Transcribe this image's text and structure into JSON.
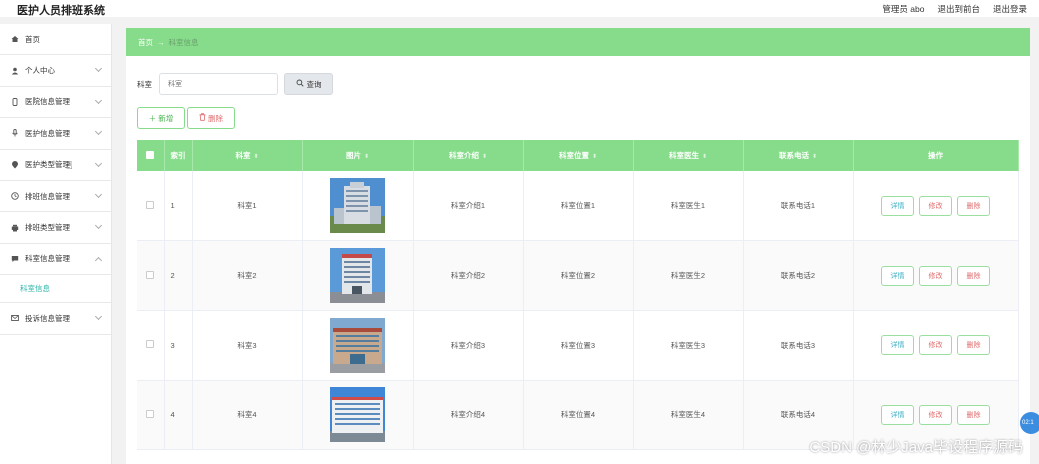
{
  "header": {
    "app_title": "医护人员排班系统",
    "user": "管理员 abo",
    "front": "退出到前台",
    "logout": "退出登录"
  },
  "sidebar": {
    "items": [
      {
        "label": "首页",
        "icon": "home-icon"
      },
      {
        "label": "个人中心",
        "icon": "user-icon"
      },
      {
        "label": "医院信息管理",
        "icon": "phone-icon"
      },
      {
        "label": "医护信息管理",
        "icon": "microphone-icon"
      },
      {
        "label": "医护类型管理",
        "icon": "location-pin-icon"
      },
      {
        "label": "排班信息管理",
        "icon": "clock-icon"
      },
      {
        "label": "排班类型管理",
        "icon": "printer-icon"
      },
      {
        "label": "科室信息管理",
        "icon": "chat-icon"
      },
      {
        "label": "投诉信息管理",
        "icon": "mail-icon"
      }
    ],
    "submenu": "科室信息"
  },
  "breadcrumb": {
    "home": "首页",
    "arrow": "→",
    "current": "科室信息"
  },
  "search": {
    "label": "科室",
    "placeholder": "科室",
    "button": "查询"
  },
  "actions": {
    "add": "新增",
    "delete": "删除"
  },
  "table": {
    "headers": [
      "索引",
      "科室",
      "图片",
      "科室介绍",
      "科室位置",
      "科室医生",
      "联系电话",
      "操作"
    ],
    "rows": [
      {
        "index": "1",
        "dept": "科室1",
        "intro": "科室介绍1",
        "location": "科室位置1",
        "doctor": "科室医生1",
        "phone": "联系电话1"
      },
      {
        "index": "2",
        "dept": "科室2",
        "intro": "科室介绍2",
        "location": "科室位置2",
        "doctor": "科室医生2",
        "phone": "联系电话2"
      },
      {
        "index": "3",
        "dept": "科室3",
        "intro": "科室介绍3",
        "location": "科室位置3",
        "doctor": "科室医生3",
        "phone": "联系电话3"
      },
      {
        "index": "4",
        "dept": "科室4",
        "intro": "科室介绍4",
        "location": "科室位置4",
        "doctor": "科室医生4",
        "phone": "联系电话4"
      }
    ],
    "row_actions": {
      "detail": "详情",
      "edit": "修改",
      "remove": "删除"
    }
  },
  "watermark": "CSDN @林少Java毕设程序源码",
  "float_time": "02:1",
  "colors": {
    "accent": "#86dc8a",
    "detail": "#3fb0c6",
    "danger": "#e06c6c",
    "active_submenu": "#2bb5a8"
  }
}
